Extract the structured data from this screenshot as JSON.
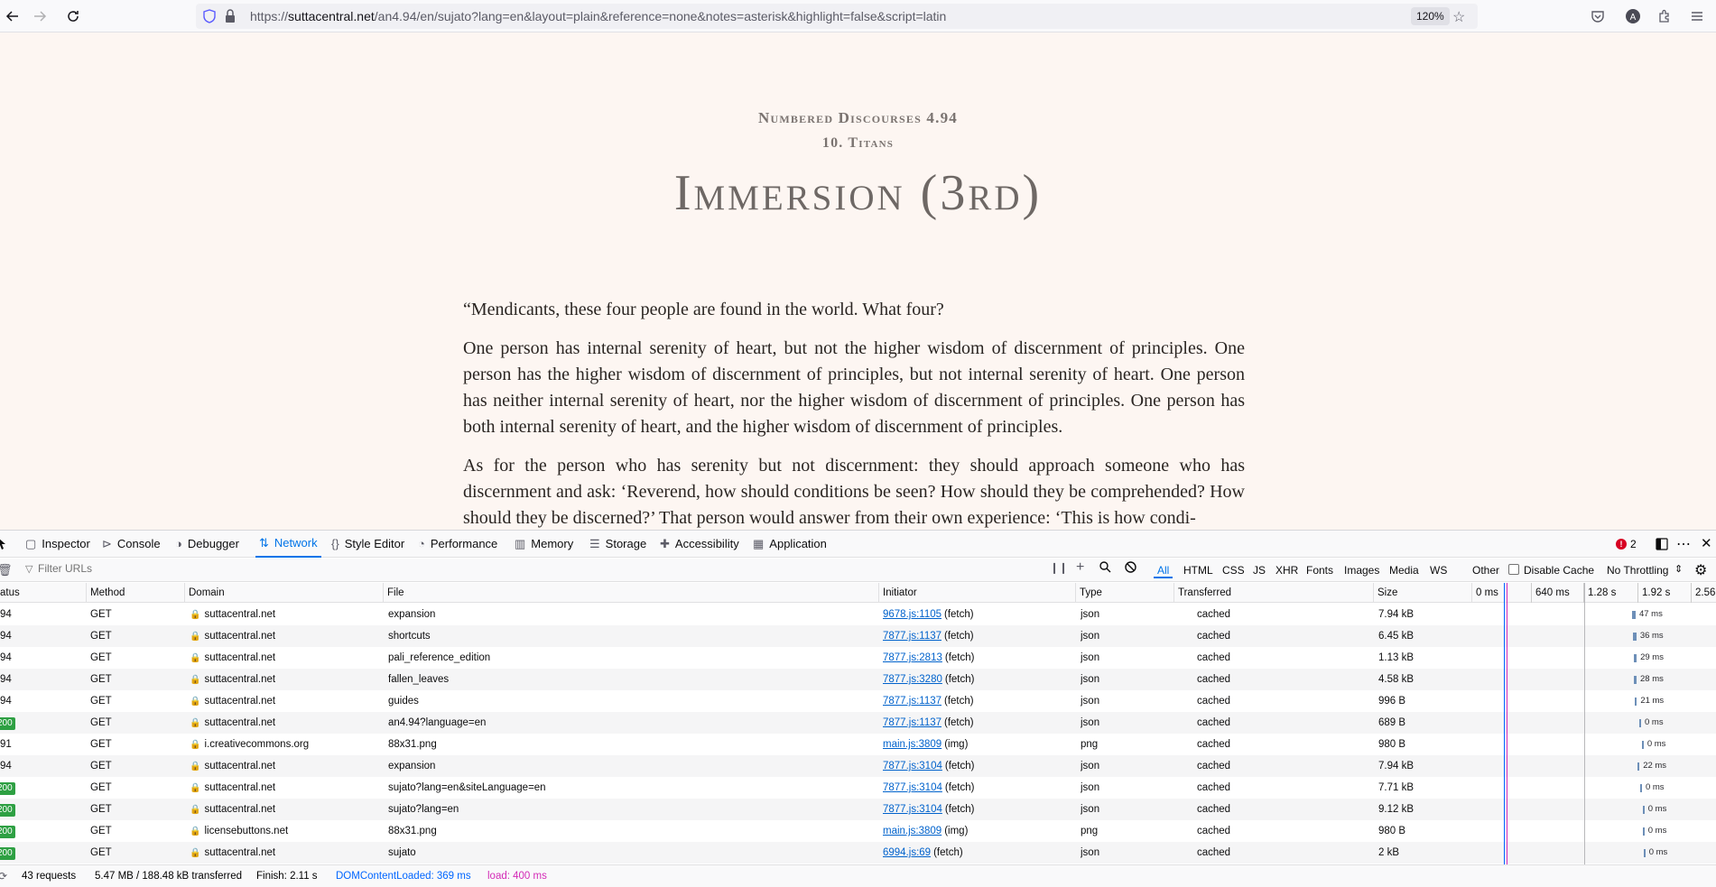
{
  "browser": {
    "url_host": "suttacentral.net",
    "url_prefix": "https://",
    "url_path": "/an4.94/en/sujato?lang=en&layout=plain&reference=none&notes=asterisk&highlight=false&script=latin",
    "zoom": "120%"
  },
  "page": {
    "collection": "Numbered Discourses 4.94",
    "chapter": "10. Titans",
    "title": "Immersion (3rd)",
    "paragraphs": [
      "“Mendicants, these four people are found in the world. What four?",
      "One person has internal serenity of heart, but not the higher wisdom of discernment of principles. One person has the higher wisdom of discernment of principles, but not internal serenity of heart. One person has neither internal serenity of heart, nor the higher wisdom of discernment of principles. One person has both internal serenity of heart, and the higher wisdom of discernment of principles.",
      "As for the person who has serenity but not discernment: they should approach someone who has discernment and ask: ‘Reverend, how should conditions be seen? How should they be comprehended? How should they be discerned?’ That person would answer from their own experience: ‘This is how condi-"
    ]
  },
  "devtools": {
    "tabs": [
      "Inspector",
      "Console",
      "Debugger",
      "Network",
      "Style Editor",
      "Performance",
      "Memory",
      "Storage",
      "Accessibility",
      "Application"
    ],
    "active_tab": "Network",
    "error_count": "2",
    "filter_placeholder": "Filter URLs",
    "types": [
      "All",
      "HTML",
      "CSS",
      "JS",
      "XHR",
      "Fonts",
      "Images",
      "Media",
      "WS",
      "Other"
    ],
    "disable_cache": "Disable Cache",
    "throttling": "No Throttling",
    "columns": [
      "atus",
      "Method",
      "Domain",
      "File",
      "Initiator",
      "Type",
      "Transferred",
      "Size"
    ],
    "timeline_ticks": [
      "0 ms",
      "640 ms",
      "1.28 s",
      "1.92 s",
      "2.56"
    ],
    "rows": [
      {
        "status": "94",
        "method": "GET",
        "domain": "suttacentral.net",
        "file": "expansion",
        "initiator": "9678.js:1105",
        "init_type": "(fetch)",
        "type": "json",
        "transferred": "cached",
        "size": "7.94 kB",
        "time": "47 ms",
        "start": 1.83
      },
      {
        "status": "94",
        "method": "GET",
        "domain": "suttacentral.net",
        "file": "shortcuts",
        "initiator": "7877.js:1137",
        "init_type": "(fetch)",
        "type": "json",
        "transferred": "cached",
        "size": "6.45 kB",
        "time": "36 ms",
        "start": 1.85
      },
      {
        "status": "94",
        "method": "GET",
        "domain": "suttacentral.net",
        "file": "pali_reference_edition",
        "initiator": "7877.js:2813",
        "init_type": "(fetch)",
        "type": "json",
        "transferred": "cached",
        "size": "1.13 kB",
        "time": "29 ms",
        "start": 1.86
      },
      {
        "status": "94",
        "method": "GET",
        "domain": "suttacentral.net",
        "file": "fallen_leaves",
        "initiator": "7877.js:3280",
        "init_type": "(fetch)",
        "type": "json",
        "transferred": "cached",
        "size": "4.58 kB",
        "time": "28 ms",
        "start": 1.86
      },
      {
        "status": "94",
        "method": "GET",
        "domain": "suttacentral.net",
        "file": "guides",
        "initiator": "7877.js:1137",
        "init_type": "(fetch)",
        "type": "json",
        "transferred": "cached",
        "size": "996 B",
        "time": "21 ms",
        "start": 1.87
      },
      {
        "status": "200",
        "method": "GET",
        "domain": "suttacentral.net",
        "file": "an4.94?language=en",
        "initiator": "7877.js:1137",
        "init_type": "(fetch)",
        "type": "json",
        "transferred": "cached",
        "size": "689 B",
        "time": "0 ms",
        "start": 1.92
      },
      {
        "status": "91",
        "method": "GET",
        "domain": "i.creativecommons.org",
        "file": "88x31.png",
        "initiator": "main.js:3809",
        "init_type": "(img)",
        "type": "png",
        "transferred": "cached",
        "size": "980 B",
        "time": "0 ms",
        "start": 1.95
      },
      {
        "status": "94",
        "method": "GET",
        "domain": "suttacentral.net",
        "file": "expansion",
        "initiator": "7877.js:3104",
        "init_type": "(fetch)",
        "type": "json",
        "transferred": "cached",
        "size": "7.94 kB",
        "time": "22 ms",
        "start": 1.9
      },
      {
        "status": "200",
        "method": "GET",
        "domain": "suttacentral.net",
        "file": "sujato?lang=en&siteLanguage=en",
        "initiator": "7877.js:3104",
        "init_type": "(fetch)",
        "type": "json",
        "transferred": "cached",
        "size": "7.71 kB",
        "time": "0 ms",
        "start": 1.93
      },
      {
        "status": "200",
        "method": "GET",
        "domain": "suttacentral.net",
        "file": "sujato?lang=en",
        "initiator": "7877.js:3104",
        "init_type": "(fetch)",
        "type": "json",
        "transferred": "cached",
        "size": "9.12 kB",
        "time": "0 ms",
        "start": 1.96
      },
      {
        "status": "200",
        "method": "GET",
        "domain": "licensebuttons.net",
        "file": "88x31.png",
        "initiator": "main.js:3809",
        "init_type": "(img)",
        "type": "png",
        "transferred": "cached",
        "size": "980 B",
        "time": "0 ms",
        "start": 1.96
      },
      {
        "status": "200",
        "method": "GET",
        "domain": "suttacentral.net",
        "file": "sujato",
        "initiator": "6994.js:69",
        "init_type": "(fetch)",
        "type": "json",
        "transferred": "cached",
        "size": "2 kB",
        "time": "0 ms",
        "start": 1.97
      }
    ],
    "summary": {
      "requests": "43 requests",
      "transferred": "5.47 MB / 188.48 kB transferred",
      "finish": "Finish: 2.11 s",
      "dom_loaded": "DOMContentLoaded: 369 ms",
      "load": "load: 400 ms"
    },
    "colors": {
      "accent": "#0074e8",
      "dom_line": "#0066ff",
      "load_line": "#d42bb7"
    }
  }
}
